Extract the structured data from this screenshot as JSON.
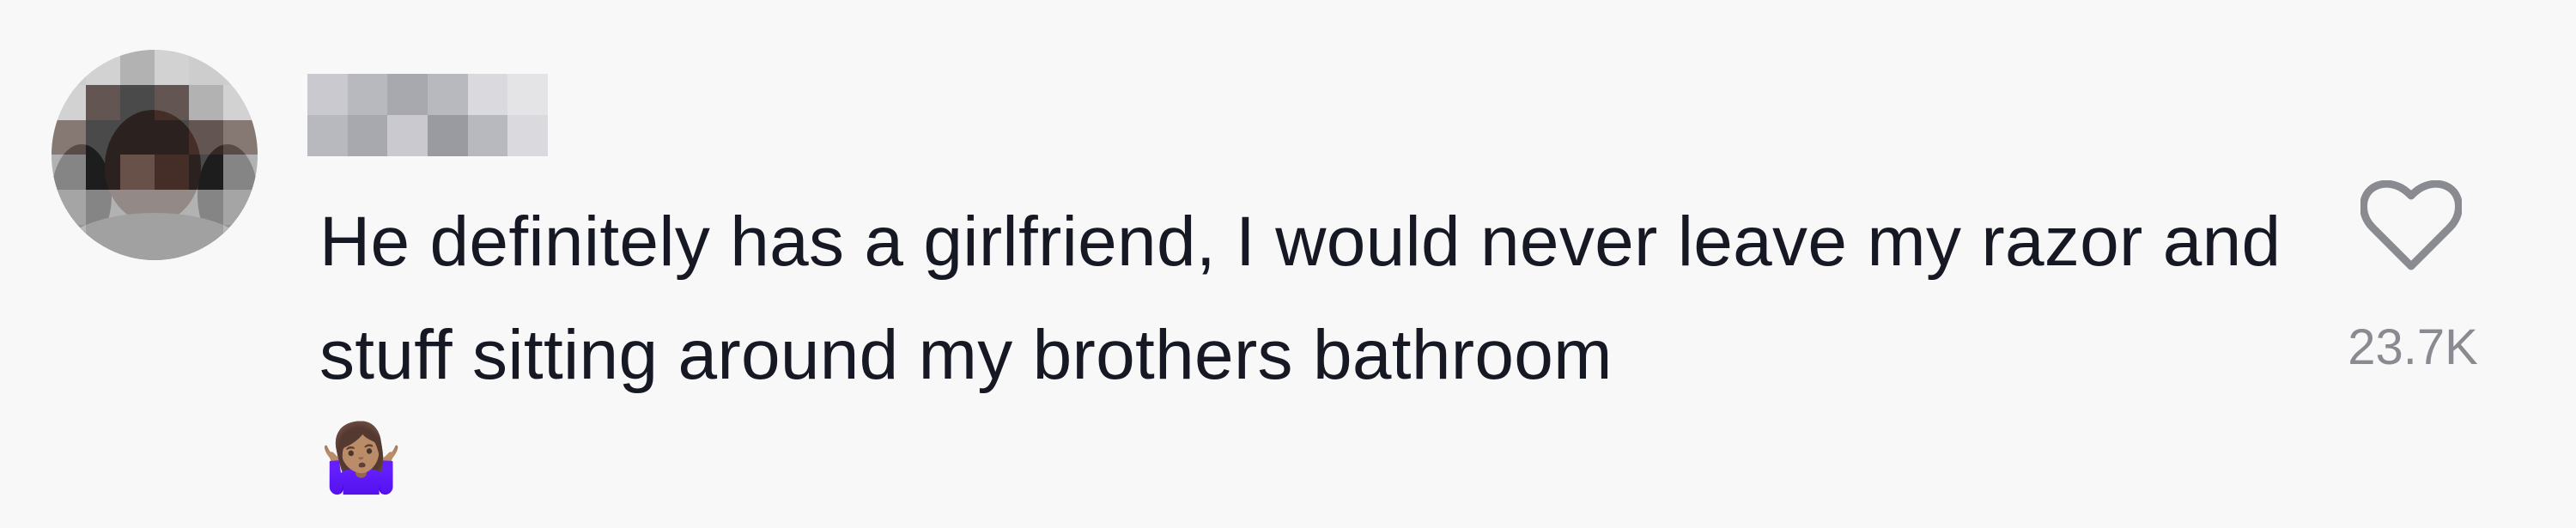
{
  "comment": {
    "text": "He definitely has a girlfriend, I would never leave my razor and stuff sitting around my brothers bathroom",
    "emoji": "🤷🏽‍♀️",
    "likes": "23.7K",
    "username_label": "",
    "avatar_label": ""
  },
  "icons": {
    "like": "heart-outline-icon",
    "emoji": "person-shrugging-icon"
  },
  "colors": {
    "background": "#f8f8f8",
    "text": "#161823",
    "muted": "#8a8b91",
    "icon": "#8a8b91",
    "avatar_blur": [
      "#d6d6d6",
      "#a9a9a9",
      "#6c5a53",
      "#3b2a24",
      "#191919",
      "#cfcfcf"
    ],
    "username_blur": [
      "#c9c9cf",
      "#b8b8bf",
      "#a8a8af",
      "#d9d9de",
      "#e4e4e7",
      "#9a9aa1"
    ]
  }
}
